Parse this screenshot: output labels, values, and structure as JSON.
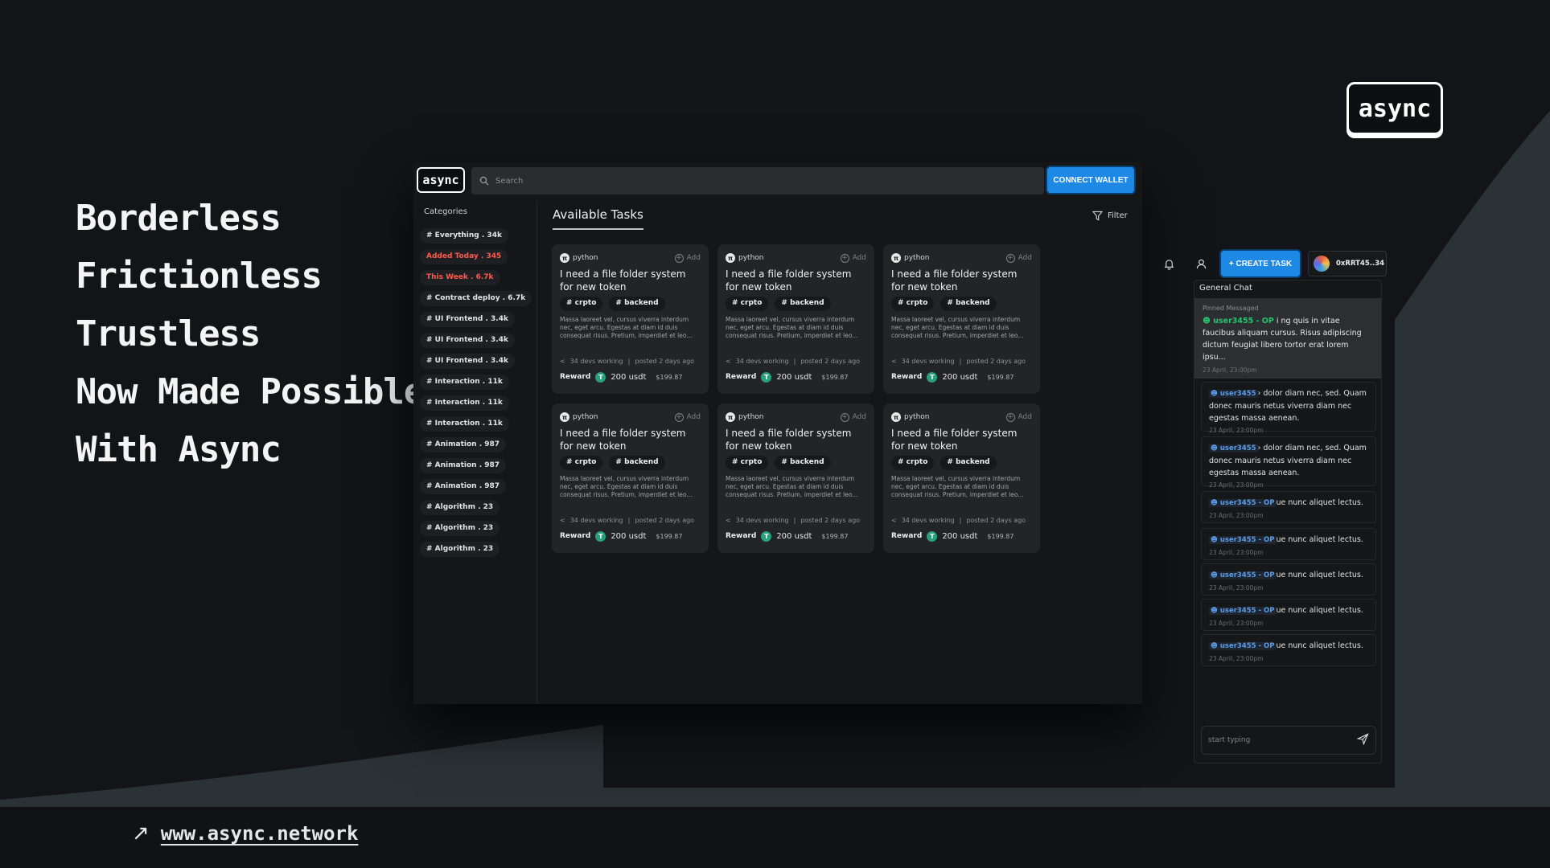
{
  "hero": {
    "lines": [
      "Borderless",
      "Frictionless",
      "Trustless",
      "Now Made Possible",
      "With Async"
    ]
  },
  "brand": {
    "logo_text": "async"
  },
  "site": {
    "url_text": "www.async.network",
    "arrow": "↗"
  },
  "app": {
    "logo_text": "async",
    "search_placeholder": "Search",
    "connect_wallet": "CONNECT WALLET",
    "categories_title": "Categories",
    "categories": [
      {
        "label": "# Everything . 34k",
        "highlight": false
      },
      {
        "label": "Added Today . 345",
        "highlight": true
      },
      {
        "label": "This Week . 6.7k",
        "highlight": true
      },
      {
        "label": "# Contract deploy . 6.7k",
        "highlight": false
      },
      {
        "label": "# UI Frontend . 3.4k",
        "highlight": false
      },
      {
        "label": "# UI Frontend . 3.4k",
        "highlight": false
      },
      {
        "label": "# UI Frontend . 3.4k",
        "highlight": false
      },
      {
        "label": "# Interaction . 11k",
        "highlight": false
      },
      {
        "label": "# Interaction . 11k",
        "highlight": false
      },
      {
        "label": "# Interaction . 11k",
        "highlight": false
      },
      {
        "label": "# Animation . 987",
        "highlight": false
      },
      {
        "label": "# Animation . 987",
        "highlight": false
      },
      {
        "label": "# Animation . 987",
        "highlight": false
      },
      {
        "label": "# Algorithm . 23",
        "highlight": false
      },
      {
        "label": "# Algorithm . 23",
        "highlight": false
      },
      {
        "label": "# Algorithm . 23",
        "highlight": false
      }
    ],
    "main_title": "Available Tasks",
    "filter_label": "Filter",
    "card": {
      "lang": "python",
      "add": "Add",
      "title": "I need a file folder system for new token",
      "tags": [
        "# crpto",
        "# backend"
      ],
      "desc": "Massa laoreet vel, cursus viverra interdum nec, eget arcu. Egestas at diam id duis consequat risus. Pretium, imperdiet et leo...",
      "devs": "34 devs working",
      "posted": "posted 2 days ago",
      "reward_label": "Reward",
      "reward_amount": "200 usdt",
      "reward_usd": "$199.87",
      "token_symbol": "T"
    },
    "card_count": 6
  },
  "chat": {
    "create_task": "+ CREATE TASK",
    "wallet": "0xRRT45..34",
    "title": "General Chat",
    "pinned_label": "Pinned Messaged",
    "pinned_user": "user3455 - OP",
    "pinned_text": "i ng quis in vitae faucibus aliquam cursus. Risus adipiscing dictum feugiat libero tortor erat lorem ipsu...",
    "pinned_time": "23 April, 23:00pm",
    "messages": [
      {
        "user": "user3455",
        "text": "› dolor diam nec, sed. Quam donec mauris netus viverra diam nec egestas massa aenean.",
        "time": "23 April, 23:00pm"
      },
      {
        "user": "user3455",
        "text": "› dolor diam nec, sed. Quam donec mauris netus viverra diam nec egestas massa aenean.",
        "time": "23 April, 23:00pm"
      },
      {
        "user": "user3455 - OP",
        "text": "ue nunc aliquet lectus.",
        "time": "23 April, 23:00pm"
      },
      {
        "user": "user3455 - OP",
        "text": "ue nunc aliquet lectus.",
        "time": "23 April, 23:00pm"
      },
      {
        "user": "user3455 - OP",
        "text": "ue nunc aliquet lectus.",
        "time": "23 April, 23:00pm"
      },
      {
        "user": "user3455 - OP",
        "text": "ue nunc aliquet lectus.",
        "time": "23 April, 23:00pm"
      },
      {
        "user": "user3455 - OP",
        "text": "ue nunc aliquet lectus.",
        "time": "23 April, 23:00pm"
      }
    ],
    "input_placeholder": "start typing"
  },
  "colors": {
    "background": "#121417",
    "accent_blue": "#1e88e5",
    "highlight_red": "#ff5a4e",
    "op_green": "#29c26e",
    "usdt_green": "#26a17b",
    "wave": "#2b3236"
  }
}
